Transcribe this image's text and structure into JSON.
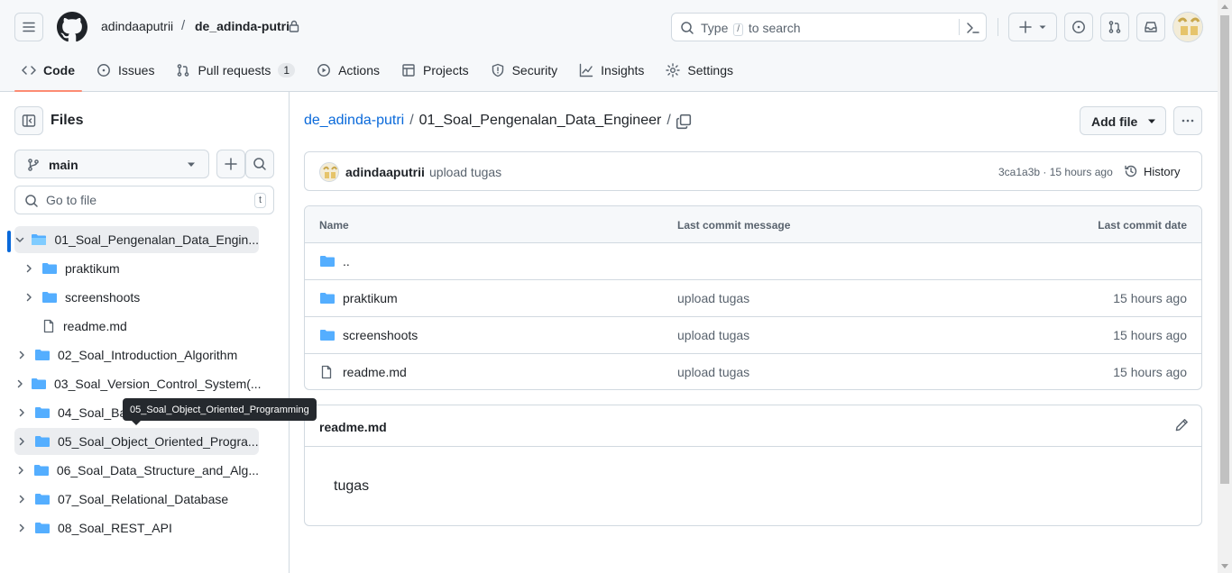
{
  "header": {
    "owner": "adindaaputrii",
    "separator": "/",
    "repo": "de_adinda-putri",
    "search_prefix": "Type",
    "search_key": "/",
    "search_suffix": "to search"
  },
  "tabs": [
    {
      "label": "Code"
    },
    {
      "label": "Issues"
    },
    {
      "label": "Pull requests",
      "count": "1"
    },
    {
      "label": "Actions"
    },
    {
      "label": "Projects"
    },
    {
      "label": "Security"
    },
    {
      "label": "Insights"
    },
    {
      "label": "Settings"
    }
  ],
  "sidebar": {
    "title": "Files",
    "branch": "main",
    "goto_placeholder": "Go to file",
    "goto_key": "t",
    "tree": [
      {
        "name": "01_Soal_Pengenalan_Data_Engin..."
      },
      {
        "name": "praktikum"
      },
      {
        "name": "screenshoots"
      },
      {
        "name": "readme.md"
      },
      {
        "name": "02_Soal_Introduction_Algorithm"
      },
      {
        "name": "03_Soal_Version_Control_System(..."
      },
      {
        "name": "04_Soal_Bas"
      },
      {
        "name": "05_Soal_Object_Oriented_Progra..."
      },
      {
        "name": "06_Soal_Data_Structure_and_Alg..."
      },
      {
        "name": "07_Soal_Relational_Database"
      },
      {
        "name": "08_Soal_REST_API"
      }
    ],
    "tooltip": "05_Soal_Object_Oriented_Programming"
  },
  "main": {
    "path_root": "de_adinda-putri",
    "path_sep": "/",
    "path_current": "01_Soal_Pengenalan_Data_Engineer",
    "path_trailing": "/",
    "add_file": "Add file",
    "commit": {
      "author": "adindaaputrii",
      "message": "upload tugas",
      "meta": "3ca1a3b · 15 hours ago",
      "history": "History"
    },
    "table": {
      "headers": [
        "Name",
        "Last commit message",
        "Last commit date"
      ],
      "parent": "..",
      "rows": [
        {
          "name": "praktikum",
          "message": "upload tugas",
          "date": "15 hours ago"
        },
        {
          "name": "screenshoots",
          "message": "upload tugas",
          "date": "15 hours ago"
        },
        {
          "name": "readme.md",
          "message": "upload tugas",
          "date": "15 hours ago"
        }
      ]
    },
    "readme": {
      "title": "readme.md",
      "body": "tugas"
    }
  },
  "colors": {
    "accent": "#0969da",
    "folder": "#54aeff",
    "tab_underline": "#fd8c73"
  }
}
